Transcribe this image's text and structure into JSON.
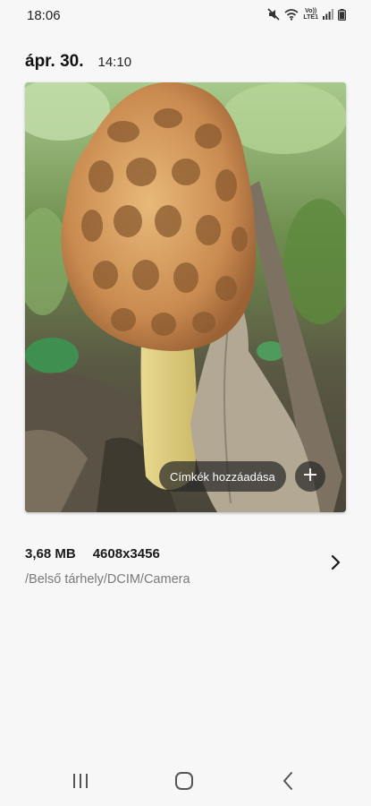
{
  "status_bar": {
    "time": "18:06",
    "network_label_top": "Vo))",
    "network_label_bottom": "LTE1",
    "icons": [
      "mute-icon",
      "wifi-icon",
      "signal-icon",
      "battery-icon"
    ]
  },
  "header": {
    "date": "ápr. 30.",
    "time": "14:10"
  },
  "photo": {
    "subject": "morel-mushroom-photo",
    "tag_label": "Címkék hozzáadása",
    "add_icon": "plus-icon"
  },
  "details": {
    "file_size": "3,68 MB",
    "resolution": "4608x3456",
    "path": "/Belső tárhely/DCIM/Camera",
    "more_icon": "chevron-right-icon"
  },
  "navbar": {
    "buttons": [
      "recents-icon",
      "home-icon",
      "back-icon"
    ]
  },
  "colors": {
    "background": "#f7f7f7",
    "pill": "#2c2c2c",
    "path_text": "#7a7a7a"
  }
}
